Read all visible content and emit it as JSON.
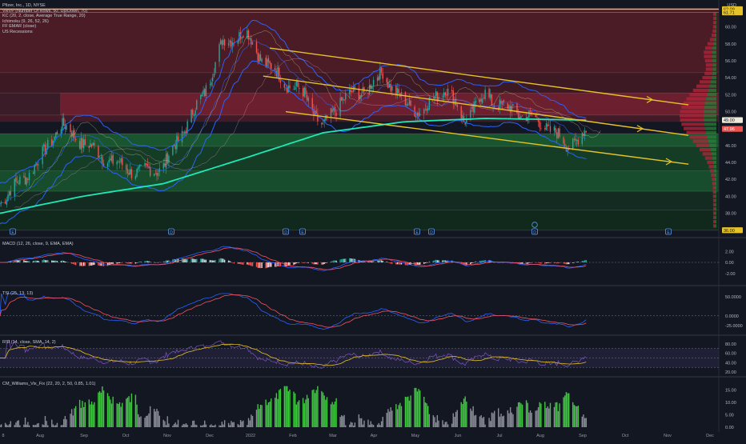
{
  "header": {
    "symbol_line": "Pfizer, Inc., 1D, NYSE",
    "currency": "USD",
    "indicators": [
      "VRVP (Number Of Rows, 50, Up/Down, 70)",
      "KC (20, 2, close, Average True Range, 20)",
      "Ichimoku (9, 26, 52, 26)",
      "FF EMAR (close)",
      "US Recessions"
    ]
  },
  "colors": {
    "background": "#131722",
    "price_up": "#26a69a",
    "price_down": "#ef5350",
    "channel": "#e6c229",
    "ema_long": "#1de9b6",
    "keltner": "#2962ff",
    "macd": "#2962ff",
    "signal": "#f7525f",
    "williams_green": "#3ec93e",
    "williams_gray": "#8a8d96",
    "resistance_line": "#e6c229"
  },
  "chart_data": [
    {
      "type": "candlestick",
      "pane": "price",
      "x_axis_labels": [
        "8",
        "Aug",
        "Sep",
        "Oct",
        "Nov",
        "Dec",
        "2022",
        "Feb",
        "Mar",
        "Apr",
        "May",
        "Jun",
        "Jul",
        "Aug",
        "Sep",
        "Oct",
        "Nov",
        "Dec"
      ],
      "y_tick_labels": [
        "38.00",
        "40.00",
        "42.00",
        "44.00",
        "46.00",
        "48.00",
        "50.00",
        "52.00",
        "54.00",
        "56.00",
        "58.00",
        "60.00"
      ],
      "ylim": [
        35.6,
        62.8
      ],
      "price_tags": [
        "62.09",
        "61.71",
        "49.00",
        "47.96",
        "36.00"
      ],
      "close_series": {
        "x": [
          "2021-07-01",
          "2021-07-15",
          "2021-08-01",
          "2021-08-15",
          "2021-09-01",
          "2021-09-15",
          "2021-10-01",
          "2021-10-15",
          "2021-11-01",
          "2021-11-15",
          "2021-12-01",
          "2021-12-15",
          "2022-01-01",
          "2022-01-15",
          "2022-02-01",
          "2022-02-15",
          "2022-03-01",
          "2022-03-15",
          "2022-04-01",
          "2022-04-15",
          "2022-05-01",
          "2022-05-15",
          "2022-06-01",
          "2022-06-15",
          "2022-07-01",
          "2022-07-15",
          "2022-08-01",
          "2022-08-15",
          "2022-09-01",
          "2022-09-15"
        ],
        "values": [
          39.5,
          41.5,
          44.5,
          48.5,
          46.5,
          44.8,
          43.5,
          42.8,
          43.5,
          47.5,
          52.0,
          58.0,
          59.5,
          56.0,
          53.5,
          52.0,
          48.0,
          51.5,
          52.5,
          54.5,
          51.0,
          50.0,
          53.0,
          49.0,
          52.0,
          50.5,
          49.5,
          48.5,
          46.0,
          47.5
        ]
      },
      "ema_long": {
        "x": [
          "2021-07-01",
          "2021-09-01",
          "2021-11-01",
          "2022-01-01",
          "2022-03-01",
          "2022-05-01",
          "2022-07-01",
          "2022-09-15"
        ],
        "values": [
          38.0,
          40.0,
          41.5,
          44.5,
          47.5,
          48.8,
          49.2,
          49.0
        ]
      },
      "descending_channel": {
        "upper": {
          "x": [
            "2022-01-20",
            "2022-12-01"
          ],
          "values": [
            57.5,
            50.8
          ]
        },
        "middle": {
          "x": [
            "2022-01-15",
            "2022-12-01"
          ],
          "values": [
            54.2,
            47.2
          ]
        },
        "lower": {
          "x": [
            "2022-02-01",
            "2022-12-01"
          ],
          "values": [
            50.0,
            43.8
          ]
        }
      },
      "horizontal_line": 62.09,
      "markers": [
        "E",
        "D",
        "D",
        "E",
        "E",
        "D",
        "D",
        "E"
      ]
    },
    {
      "type": "histogram",
      "pane": "MACD",
      "title": "MACD (12, 26, close, 9, EMA, EMA)",
      "y_tick_labels": [
        "2.00",
        "0.00",
        "-2.00"
      ],
      "ylim": [
        -3.2,
        3.2
      ]
    },
    {
      "type": "line",
      "pane": "TSI",
      "title": "TSI (25, 13, 13)",
      "y_tick_labels": [
        "50.0000",
        "0.0000",
        "-25.0000"
      ],
      "ylim": [
        -40,
        60
      ]
    },
    {
      "type": "line",
      "pane": "RSI",
      "title": "RSI (14, close, SMA, 14, 2)",
      "y_tick_labels": [
        "80.00",
        "60.00",
        "40.00",
        "20.00"
      ],
      "ylim": [
        15,
        90
      ]
    },
    {
      "type": "bar",
      "pane": "CM_Williams_Vix_Fix",
      "title": "CM_Williams_Vix_Fix (22, 20, 2, 50, 0.85, 1.01)",
      "y_tick_labels": [
        "15.00",
        "10.00",
        "5.00",
        "0.00"
      ],
      "ylim": [
        0,
        18
      ]
    }
  ]
}
